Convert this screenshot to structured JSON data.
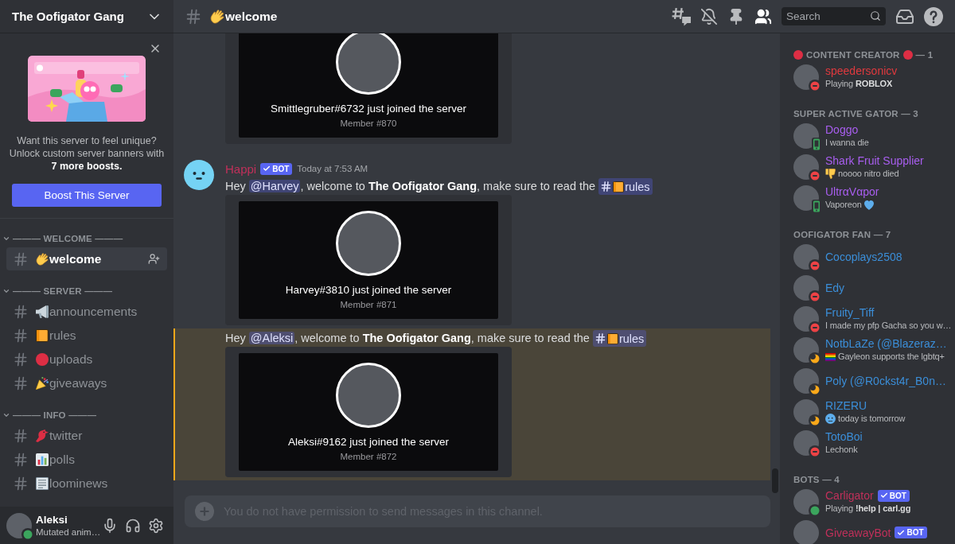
{
  "server": {
    "name": "The Oofigator Gang"
  },
  "boost_card": {
    "text": "Want this server to feel unique? Unlock custom server banners with **7 more boosts.**",
    "button": "Boost This Server"
  },
  "categories": [
    {
      "title": "——— WELCOME ———",
      "expanded": true,
      "channels": [
        {
          "name": "welcome",
          "emoji": {
            "kind": "wave"
          },
          "selected": true
        }
      ]
    },
    {
      "title": "——— SERVER ———",
      "expanded": true,
      "channels": [
        {
          "name": "announcements",
          "emoji": {
            "kind": "megaphone"
          },
          "selected": false
        },
        {
          "name": "rules",
          "emoji": {
            "kind": "ledger"
          },
          "selected": false
        },
        {
          "name": "uploads",
          "emoji": {
            "kind": "dot"
          },
          "selected": false
        },
        {
          "name": "giveaways",
          "emoji": {
            "kind": "popper"
          },
          "selected": false
        }
      ]
    },
    {
      "title": "——— INFO ———",
      "expanded": true,
      "channels": [
        {
          "name": "twitter",
          "emoji": {
            "kind": "bird"
          },
          "selected": false
        },
        {
          "name": "polls",
          "emoji": {
            "kind": "chart"
          },
          "selected": false
        },
        {
          "name": "loominews",
          "emoji": {
            "kind": "newspaper"
          },
          "selected": false
        }
      ]
    }
  ],
  "user_panel": {
    "name": "Aleksi",
    "status_text": "Mutated anim…",
    "status": {
      "kind": "online"
    }
  },
  "header": {
    "channel": "welcome",
    "emoji": {
      "kind": "wave"
    },
    "member_list_visible": true,
    "search_placeholder": "Search"
  },
  "messages": [
    {
      "highlighted": false,
      "embed": {
        "title": "Smittlegruber#6732 just joined the server",
        "subtitle": "Member #870"
      }
    },
    {
      "highlighted": false,
      "author": "Happi",
      "badge": "BOT",
      "time": "Today at 7:53 AM",
      "content": [
        {
          "kind": "text",
          "text": "Hey "
        },
        {
          "kind": "mention",
          "text": "@Harvey"
        },
        {
          "kind": "text",
          "text": ", welcome to **The Oofigator Gang**, make sure to read the "
        },
        {
          "kind": "channel",
          "text": "rules",
          "emoji": {
            "kind": "ledger"
          }
        }
      ],
      "embed": {
        "title": "Harvey#3810 just joined the server",
        "subtitle": "Member #871"
      }
    },
    {
      "highlighted": true,
      "content": [
        {
          "kind": "text",
          "text": "Hey "
        },
        {
          "kind": "mention",
          "text": "@Aleksi"
        },
        {
          "kind": "text",
          "text": ", welcome to **The Oofigator Gang**, make sure to read the "
        },
        {
          "kind": "channel",
          "text": "rules",
          "emoji": {
            "kind": "ledger"
          }
        }
      ],
      "embed": {
        "title": "Aleksi#9162 just joined the server",
        "subtitle": "Member #872"
      }
    }
  ],
  "composer": {
    "placeholder": "You do not have permission to send messages in this channel.",
    "disabled": true
  },
  "member_sections": [
    {
      "title": "CONTENT CREATOR",
      "count": "— 1",
      "emoji": {
        "kind": "dot"
      },
      "color": "#e0393e",
      "members": [
        {
          "name": "speedersonicv",
          "status": {
            "kind": "dnd"
          },
          "activity": "Playing **ROBLOX**"
        }
      ]
    },
    {
      "title": "SUPER ACTIVE GATOR — 3",
      "color": "#a95ef0",
      "members": [
        {
          "name": "Doggo",
          "status": {
            "kind": "mobile"
          },
          "activity": "I wanna die"
        },
        {
          "name": "Shark Fruit Supplier",
          "status": {
            "kind": "dnd"
          },
          "activity": "noooo nitro died",
          "activity_emoji": {
            "kind": "thumbsdown"
          }
        },
        {
          "name": "UltrαVαpor",
          "status": {
            "kind": "mobile"
          },
          "activity": "Vaporeon",
          "trailing_emoji": {
            "kind": "heart"
          }
        }
      ]
    },
    {
      "title": "OOFIGATOR FAN — 7",
      "color": "#3b8ed8",
      "members": [
        {
          "name": "Cocoplays2508",
          "status": {
            "kind": "dnd"
          }
        },
        {
          "name": "Edy",
          "status": {
            "kind": "dnd"
          }
        },
        {
          "name": "Fruity_Tiff",
          "status": {
            "kind": "dnd"
          },
          "activity": "I made my pfp Gacha so you w…"
        },
        {
          "name": "NotbLaZe (@Blazeraz…",
          "status": {
            "kind": "idle"
          },
          "activity": "Gayleon supports the lgbtq+",
          "activity_emoji": {
            "kind": "flag"
          }
        },
        {
          "name": "Poly (@R0ckst4r_B0n…",
          "status": {
            "kind": "idle"
          }
        },
        {
          "name": "RIZERU",
          "status": {
            "kind": "idle"
          },
          "activity": "today is tomorrow",
          "activity_emoji": {
            "kind": "coldface"
          }
        },
        {
          "name": "TotoBoi",
          "status": {
            "kind": "dnd"
          },
          "activity": "Lechonk"
        }
      ]
    },
    {
      "title": "BOTS — 4",
      "color": "#c0305a",
      "members": [
        {
          "name": "Carligator",
          "badge": "BOT",
          "status": {
            "kind": "online"
          },
          "activity": "Playing **!help | carl.gg**"
        },
        {
          "name": "GiveawayBot",
          "badge": "BOT"
        }
      ]
    }
  ]
}
